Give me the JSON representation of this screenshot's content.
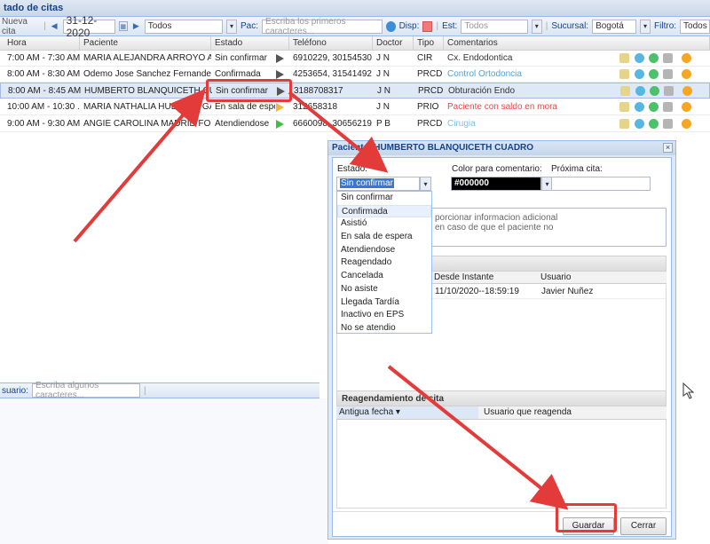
{
  "panel_title": "tado de citas",
  "toolbar": {
    "new_label": "Nueva cita",
    "date": "31-12-2020",
    "filter_select": "Todos",
    "pac_label": "Pac:",
    "pac_placeholder": "Escriba los primeros caracteres...",
    "disp_label": "Disp:",
    "est_label": "Est:",
    "est_select": "Todos",
    "sucursal_label": "Sucursal:",
    "sucursal_value": "Bogotá",
    "filtro_label": "Filtro:",
    "filtro_value": "Todos"
  },
  "grid": {
    "columns": [
      "Hora",
      "Paciente",
      "Estado",
      "Teléfono",
      "Doctor",
      "Tipo",
      "Comentarios"
    ],
    "rows": [
      {
        "hora": "7:00 AM - 7:30 AM",
        "paciente": "MARIA ALEJANDRA ARROYO ALC...",
        "estado": "Sin confirmar",
        "telefono": "6910229, 30154530...",
        "doctor": "J N",
        "tipo": "CIR",
        "comentario": "Cx. Endodontica",
        "comment_color": "#333333",
        "status_color": "#555555"
      },
      {
        "hora": "8:00 AM - 8:30 AM",
        "paciente": "Odemo Jose Sanchez Fernandez",
        "estado": "Confirmada",
        "telefono": "4253654, 31541492...",
        "doctor": "J N",
        "tipo": "PRCD",
        "comentario": "Control Ortodoncia",
        "comment_color": "#4aa3df",
        "status_color": "#555555"
      },
      {
        "hora": "8:00 AM - 8:45 AM",
        "paciente": "HUMBERTO BLANQUICETH CUAD...",
        "estado": "Sin confirmar",
        "telefono": "3188708317",
        "doctor": "J N",
        "tipo": "PRCD",
        "comentario": "Obturación Endo",
        "comment_color": "#333333",
        "status_color": "#555555"
      },
      {
        "hora": "10:00 AM - 10:30 ...",
        "paciente": "MARIA NATHALIA HUERTAS GAR...",
        "estado": "En sala de espe",
        "telefono": "312658318",
        "doctor": "J N",
        "tipo": "PRIO",
        "comentario": "Paciente con saldo en mora",
        "comment_color": "#e84a4a",
        "status_color": "#f5b53f"
      },
      {
        "hora": "9:00 AM - 9:30 AM",
        "paciente": "ANGIE CAROLINA MADRID FO...",
        "estado": "Atendiendose",
        "telefono": "6660098, 30656219...",
        "doctor": "P B",
        "tipo": "PRCD",
        "comentario": "Cirugia",
        "comment_color": "#6fc6e8",
        "status_color": "#3fbf3f"
      }
    ]
  },
  "bottom_bar": {
    "label": "suario:",
    "placeholder": "Escriba algunos caracteres..."
  },
  "dialog": {
    "title": "Paciente: HUMBERTO BLANQUICETH CUADRO",
    "close": "×",
    "estado_label": "Estado:",
    "estado_value": "Sin confirmar",
    "color_label": "Color para comentario:",
    "color_value": "#000000",
    "proxima_label": "Próxima cita:",
    "comment_placeholder": "porcionar informacion adicional en caso de que el paciente no",
    "dropdown_options": [
      "Sin confirmar",
      "Confirmada",
      "Asistió",
      "En sala de espera",
      "Atendiendose",
      "Reagendado",
      "Cancelada",
      "No asiste",
      "Llegada Tardía",
      "Inactivo en EPS",
      "No se atendio"
    ],
    "history_cols": [
      "Desde Instante",
      "Usuario"
    ],
    "history_row": {
      "instante": "11/10/2020--18:59:19",
      "usuario": "Javier Nuñez"
    },
    "reagend_title": "Reagendamiento de cita",
    "reagend_cols": [
      "Antigua fecha ▾",
      "Usuario que reagenda"
    ],
    "save_label": "Guardar",
    "close_label": "Cerrar"
  },
  "colors": {
    "annotation": "#e33a3a",
    "disp_swatch": "#f07a7a"
  }
}
